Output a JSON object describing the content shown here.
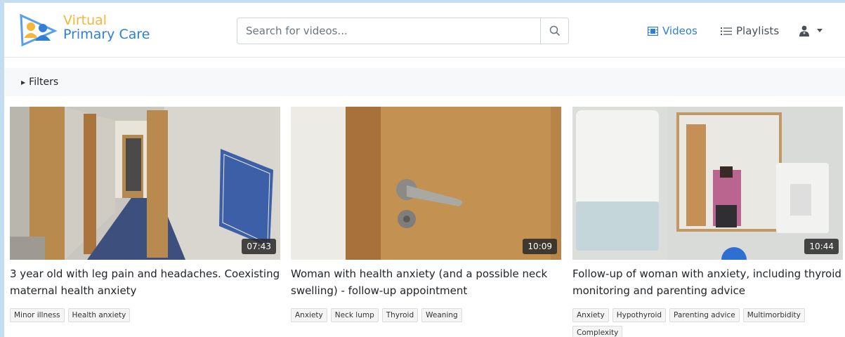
{
  "logo": {
    "line1": "Virtual",
    "line2": "Primary Care"
  },
  "search": {
    "placeholder": "Search for videos...",
    "icon": "search-icon"
  },
  "nav": {
    "videos_label": "Videos",
    "playlists_label": "Playlists",
    "user_icon": "user-md-icon",
    "accent_color": "#2f7fd8"
  },
  "filters": {
    "label": "Filters"
  },
  "videos": [
    {
      "duration": "07:43",
      "title": "3 year old with leg pain and headaches. Coexisting maternal health anxiety",
      "tags": [
        "Minor illness",
        "Health anxiety"
      ]
    },
    {
      "duration": "10:09",
      "title": "Woman with health anxiety (and a possible neck swelling) - follow-up appointment",
      "tags": [
        "Anxiety",
        "Neck lump",
        "Thyroid",
        "Weaning"
      ]
    },
    {
      "duration": "10:44",
      "title": "Follow-up of woman with anxiety, including thyroid monitoring and parenting advice",
      "tags": [
        "Anxiety",
        "Hypothyroid",
        "Parenting advice",
        "Multimorbidity",
        "Complexity"
      ]
    }
  ]
}
